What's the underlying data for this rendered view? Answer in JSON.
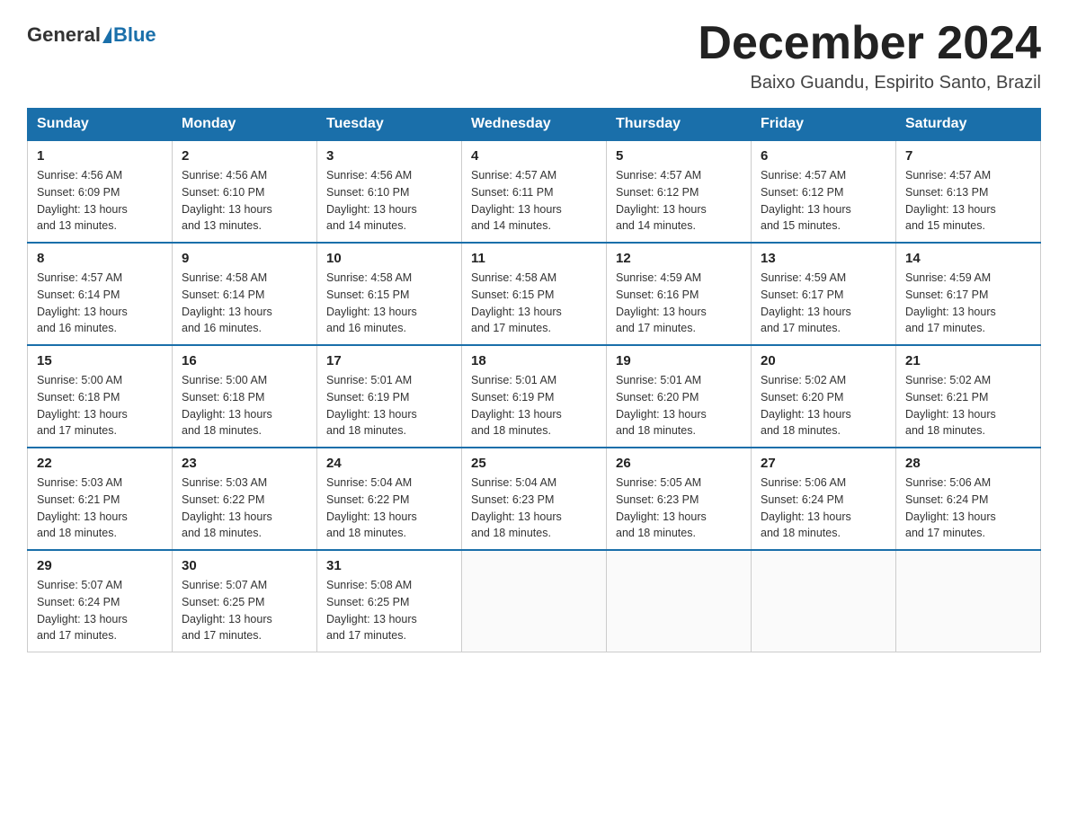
{
  "header": {
    "logo_general": "General",
    "logo_blue": "Blue",
    "month_title": "December 2024",
    "location": "Baixo Guandu, Espirito Santo, Brazil"
  },
  "days_of_week": [
    "Sunday",
    "Monday",
    "Tuesday",
    "Wednesday",
    "Thursday",
    "Friday",
    "Saturday"
  ],
  "weeks": [
    [
      {
        "day": "1",
        "info": "Sunrise: 4:56 AM\nSunset: 6:09 PM\nDaylight: 13 hours\nand 13 minutes."
      },
      {
        "day": "2",
        "info": "Sunrise: 4:56 AM\nSunset: 6:10 PM\nDaylight: 13 hours\nand 13 minutes."
      },
      {
        "day": "3",
        "info": "Sunrise: 4:56 AM\nSunset: 6:10 PM\nDaylight: 13 hours\nand 14 minutes."
      },
      {
        "day": "4",
        "info": "Sunrise: 4:57 AM\nSunset: 6:11 PM\nDaylight: 13 hours\nand 14 minutes."
      },
      {
        "day": "5",
        "info": "Sunrise: 4:57 AM\nSunset: 6:12 PM\nDaylight: 13 hours\nand 14 minutes."
      },
      {
        "day": "6",
        "info": "Sunrise: 4:57 AM\nSunset: 6:12 PM\nDaylight: 13 hours\nand 15 minutes."
      },
      {
        "day": "7",
        "info": "Sunrise: 4:57 AM\nSunset: 6:13 PM\nDaylight: 13 hours\nand 15 minutes."
      }
    ],
    [
      {
        "day": "8",
        "info": "Sunrise: 4:57 AM\nSunset: 6:14 PM\nDaylight: 13 hours\nand 16 minutes."
      },
      {
        "day": "9",
        "info": "Sunrise: 4:58 AM\nSunset: 6:14 PM\nDaylight: 13 hours\nand 16 minutes."
      },
      {
        "day": "10",
        "info": "Sunrise: 4:58 AM\nSunset: 6:15 PM\nDaylight: 13 hours\nand 16 minutes."
      },
      {
        "day": "11",
        "info": "Sunrise: 4:58 AM\nSunset: 6:15 PM\nDaylight: 13 hours\nand 17 minutes."
      },
      {
        "day": "12",
        "info": "Sunrise: 4:59 AM\nSunset: 6:16 PM\nDaylight: 13 hours\nand 17 minutes."
      },
      {
        "day": "13",
        "info": "Sunrise: 4:59 AM\nSunset: 6:17 PM\nDaylight: 13 hours\nand 17 minutes."
      },
      {
        "day": "14",
        "info": "Sunrise: 4:59 AM\nSunset: 6:17 PM\nDaylight: 13 hours\nand 17 minutes."
      }
    ],
    [
      {
        "day": "15",
        "info": "Sunrise: 5:00 AM\nSunset: 6:18 PM\nDaylight: 13 hours\nand 17 minutes."
      },
      {
        "day": "16",
        "info": "Sunrise: 5:00 AM\nSunset: 6:18 PM\nDaylight: 13 hours\nand 18 minutes."
      },
      {
        "day": "17",
        "info": "Sunrise: 5:01 AM\nSunset: 6:19 PM\nDaylight: 13 hours\nand 18 minutes."
      },
      {
        "day": "18",
        "info": "Sunrise: 5:01 AM\nSunset: 6:19 PM\nDaylight: 13 hours\nand 18 minutes."
      },
      {
        "day": "19",
        "info": "Sunrise: 5:01 AM\nSunset: 6:20 PM\nDaylight: 13 hours\nand 18 minutes."
      },
      {
        "day": "20",
        "info": "Sunrise: 5:02 AM\nSunset: 6:20 PM\nDaylight: 13 hours\nand 18 minutes."
      },
      {
        "day": "21",
        "info": "Sunrise: 5:02 AM\nSunset: 6:21 PM\nDaylight: 13 hours\nand 18 minutes."
      }
    ],
    [
      {
        "day": "22",
        "info": "Sunrise: 5:03 AM\nSunset: 6:21 PM\nDaylight: 13 hours\nand 18 minutes."
      },
      {
        "day": "23",
        "info": "Sunrise: 5:03 AM\nSunset: 6:22 PM\nDaylight: 13 hours\nand 18 minutes."
      },
      {
        "day": "24",
        "info": "Sunrise: 5:04 AM\nSunset: 6:22 PM\nDaylight: 13 hours\nand 18 minutes."
      },
      {
        "day": "25",
        "info": "Sunrise: 5:04 AM\nSunset: 6:23 PM\nDaylight: 13 hours\nand 18 minutes."
      },
      {
        "day": "26",
        "info": "Sunrise: 5:05 AM\nSunset: 6:23 PM\nDaylight: 13 hours\nand 18 minutes."
      },
      {
        "day": "27",
        "info": "Sunrise: 5:06 AM\nSunset: 6:24 PM\nDaylight: 13 hours\nand 18 minutes."
      },
      {
        "day": "28",
        "info": "Sunrise: 5:06 AM\nSunset: 6:24 PM\nDaylight: 13 hours\nand 17 minutes."
      }
    ],
    [
      {
        "day": "29",
        "info": "Sunrise: 5:07 AM\nSunset: 6:24 PM\nDaylight: 13 hours\nand 17 minutes."
      },
      {
        "day": "30",
        "info": "Sunrise: 5:07 AM\nSunset: 6:25 PM\nDaylight: 13 hours\nand 17 minutes."
      },
      {
        "day": "31",
        "info": "Sunrise: 5:08 AM\nSunset: 6:25 PM\nDaylight: 13 hours\nand 17 minutes."
      },
      {
        "day": "",
        "info": ""
      },
      {
        "day": "",
        "info": ""
      },
      {
        "day": "",
        "info": ""
      },
      {
        "day": "",
        "info": ""
      }
    ]
  ]
}
